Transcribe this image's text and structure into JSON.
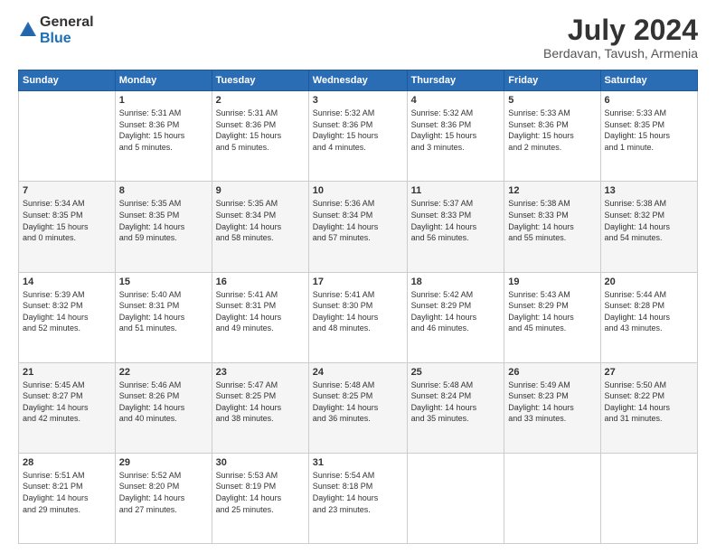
{
  "header": {
    "logo_general": "General",
    "logo_blue": "Blue",
    "month_title": "July 2024",
    "location": "Berdavan, Tavush, Armenia"
  },
  "calendar": {
    "days_of_week": [
      "Sunday",
      "Monday",
      "Tuesday",
      "Wednesday",
      "Thursday",
      "Friday",
      "Saturday"
    ],
    "weeks": [
      [
        {
          "day": "",
          "info": ""
        },
        {
          "day": "1",
          "info": "Sunrise: 5:31 AM\nSunset: 8:36 PM\nDaylight: 15 hours\nand 5 minutes."
        },
        {
          "day": "2",
          "info": "Sunrise: 5:31 AM\nSunset: 8:36 PM\nDaylight: 15 hours\nand 5 minutes."
        },
        {
          "day": "3",
          "info": "Sunrise: 5:32 AM\nSunset: 8:36 PM\nDaylight: 15 hours\nand 4 minutes."
        },
        {
          "day": "4",
          "info": "Sunrise: 5:32 AM\nSunset: 8:36 PM\nDaylight: 15 hours\nand 3 minutes."
        },
        {
          "day": "5",
          "info": "Sunrise: 5:33 AM\nSunset: 8:36 PM\nDaylight: 15 hours\nand 2 minutes."
        },
        {
          "day": "6",
          "info": "Sunrise: 5:33 AM\nSunset: 8:35 PM\nDaylight: 15 hours\nand 1 minute."
        }
      ],
      [
        {
          "day": "7",
          "info": "Sunrise: 5:34 AM\nSunset: 8:35 PM\nDaylight: 15 hours\nand 0 minutes."
        },
        {
          "day": "8",
          "info": "Sunrise: 5:35 AM\nSunset: 8:35 PM\nDaylight: 14 hours\nand 59 minutes."
        },
        {
          "day": "9",
          "info": "Sunrise: 5:35 AM\nSunset: 8:34 PM\nDaylight: 14 hours\nand 58 minutes."
        },
        {
          "day": "10",
          "info": "Sunrise: 5:36 AM\nSunset: 8:34 PM\nDaylight: 14 hours\nand 57 minutes."
        },
        {
          "day": "11",
          "info": "Sunrise: 5:37 AM\nSunset: 8:33 PM\nDaylight: 14 hours\nand 56 minutes."
        },
        {
          "day": "12",
          "info": "Sunrise: 5:38 AM\nSunset: 8:33 PM\nDaylight: 14 hours\nand 55 minutes."
        },
        {
          "day": "13",
          "info": "Sunrise: 5:38 AM\nSunset: 8:32 PM\nDaylight: 14 hours\nand 54 minutes."
        }
      ],
      [
        {
          "day": "14",
          "info": "Sunrise: 5:39 AM\nSunset: 8:32 PM\nDaylight: 14 hours\nand 52 minutes."
        },
        {
          "day": "15",
          "info": "Sunrise: 5:40 AM\nSunset: 8:31 PM\nDaylight: 14 hours\nand 51 minutes."
        },
        {
          "day": "16",
          "info": "Sunrise: 5:41 AM\nSunset: 8:31 PM\nDaylight: 14 hours\nand 49 minutes."
        },
        {
          "day": "17",
          "info": "Sunrise: 5:41 AM\nSunset: 8:30 PM\nDaylight: 14 hours\nand 48 minutes."
        },
        {
          "day": "18",
          "info": "Sunrise: 5:42 AM\nSunset: 8:29 PM\nDaylight: 14 hours\nand 46 minutes."
        },
        {
          "day": "19",
          "info": "Sunrise: 5:43 AM\nSunset: 8:29 PM\nDaylight: 14 hours\nand 45 minutes."
        },
        {
          "day": "20",
          "info": "Sunrise: 5:44 AM\nSunset: 8:28 PM\nDaylight: 14 hours\nand 43 minutes."
        }
      ],
      [
        {
          "day": "21",
          "info": "Sunrise: 5:45 AM\nSunset: 8:27 PM\nDaylight: 14 hours\nand 42 minutes."
        },
        {
          "day": "22",
          "info": "Sunrise: 5:46 AM\nSunset: 8:26 PM\nDaylight: 14 hours\nand 40 minutes."
        },
        {
          "day": "23",
          "info": "Sunrise: 5:47 AM\nSunset: 8:25 PM\nDaylight: 14 hours\nand 38 minutes."
        },
        {
          "day": "24",
          "info": "Sunrise: 5:48 AM\nSunset: 8:25 PM\nDaylight: 14 hours\nand 36 minutes."
        },
        {
          "day": "25",
          "info": "Sunrise: 5:48 AM\nSunset: 8:24 PM\nDaylight: 14 hours\nand 35 minutes."
        },
        {
          "day": "26",
          "info": "Sunrise: 5:49 AM\nSunset: 8:23 PM\nDaylight: 14 hours\nand 33 minutes."
        },
        {
          "day": "27",
          "info": "Sunrise: 5:50 AM\nSunset: 8:22 PM\nDaylight: 14 hours\nand 31 minutes."
        }
      ],
      [
        {
          "day": "28",
          "info": "Sunrise: 5:51 AM\nSunset: 8:21 PM\nDaylight: 14 hours\nand 29 minutes."
        },
        {
          "day": "29",
          "info": "Sunrise: 5:52 AM\nSunset: 8:20 PM\nDaylight: 14 hours\nand 27 minutes."
        },
        {
          "day": "30",
          "info": "Sunrise: 5:53 AM\nSunset: 8:19 PM\nDaylight: 14 hours\nand 25 minutes."
        },
        {
          "day": "31",
          "info": "Sunrise: 5:54 AM\nSunset: 8:18 PM\nDaylight: 14 hours\nand 23 minutes."
        },
        {
          "day": "",
          "info": ""
        },
        {
          "day": "",
          "info": ""
        },
        {
          "day": "",
          "info": ""
        }
      ]
    ]
  }
}
